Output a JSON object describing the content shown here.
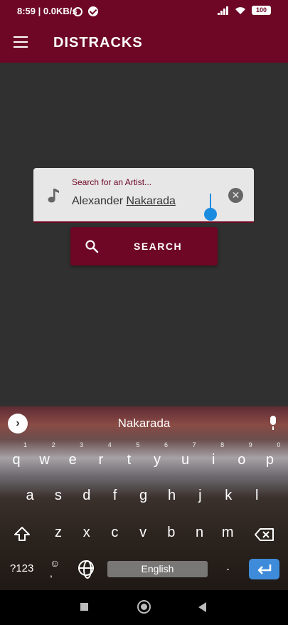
{
  "status_bar": {
    "time": "8:59",
    "net_speed": "0.0KB/s",
    "battery": "100"
  },
  "app_bar": {
    "title": "DISTRACKS",
    "menu_icon": "hamburger-menu-icon",
    "color": "#6d0725"
  },
  "search": {
    "label": "Search for an Artist...",
    "value_first": "Alexander ",
    "value_second": "Nakarada",
    "button_label": "SEARCH",
    "leading_icon": "music-note-icon",
    "clear_icon": "close-icon"
  },
  "keyboard": {
    "suggestion": "Nakarada",
    "row1": [
      "q",
      "w",
      "e",
      "r",
      "t",
      "y",
      "u",
      "i",
      "o",
      "p"
    ],
    "row1_hints": [
      "1",
      "2",
      "3",
      "4",
      "5",
      "6",
      "7",
      "8",
      "9",
      "0"
    ],
    "row2": [
      "a",
      "s",
      "d",
      "f",
      "g",
      "h",
      "j",
      "k",
      "l"
    ],
    "row3": [
      "z",
      "x",
      "c",
      "v",
      "b",
      "n",
      "m"
    ],
    "symbols_label": "?123",
    "comma_label": ",",
    "space_label": "English",
    "period_label": ".",
    "accent_color": "#3e8bd9"
  }
}
